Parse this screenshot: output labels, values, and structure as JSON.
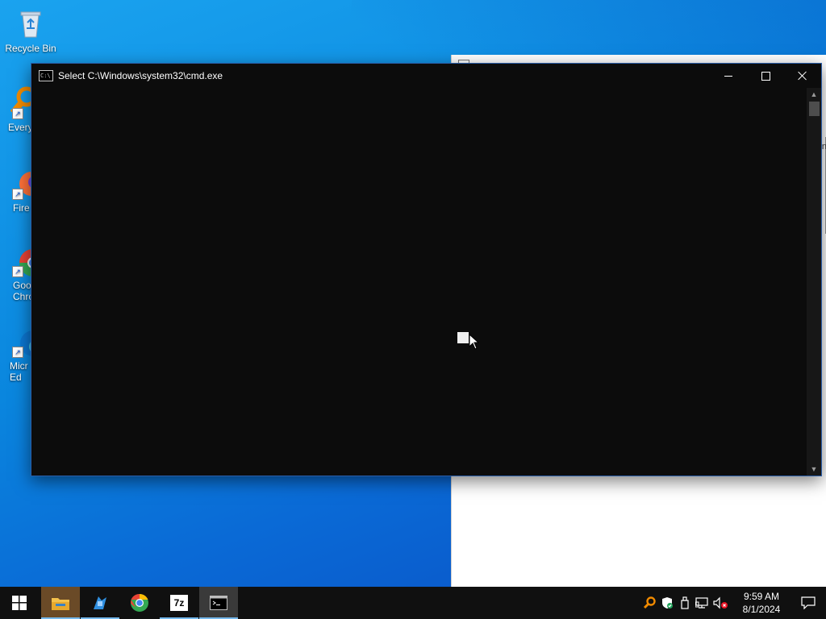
{
  "desktop": {
    "icons": [
      {
        "label": "Recycle Bin"
      },
      {
        "label": "Every"
      },
      {
        "label": "Fire"
      },
      {
        "label": "Goo\nChro"
      },
      {
        "label": "Micr\nEd"
      }
    ]
  },
  "background_window": {
    "edge_text": "nt"
  },
  "cmd_window": {
    "title": "Select C:\\Windows\\system32\\cmd.exe",
    "icon_text": "C:\\"
  },
  "taskbar": {
    "apps": [
      {
        "name": "file-explorer"
      },
      {
        "name": "blue-tool"
      },
      {
        "name": "google-chrome"
      },
      {
        "name": "7-zip",
        "label": "7z"
      },
      {
        "name": "command-prompt"
      }
    ],
    "clock": {
      "time": "9:59 AM",
      "date": "8/1/2024"
    }
  },
  "colors": {
    "console_bg": "#0c0c0c",
    "taskbar_bg": "#101010",
    "desktop_blue": "#0a86de"
  }
}
